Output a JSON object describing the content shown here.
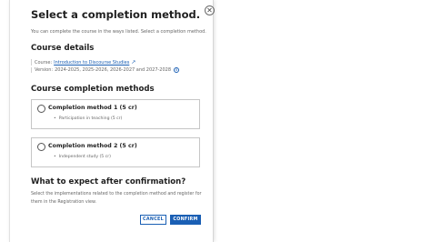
{
  "dialog": {
    "title": "Select a completion method.",
    "subtitle": "You can complete the course in the ways listed. Select a completion method.",
    "close_icon": "close-circle-icon"
  },
  "course_details": {
    "heading": "Course details",
    "course_label": "Course:",
    "course_link": "Introduction to Discourse Studies",
    "external_icon": "external-link-icon",
    "version_label": "Version:",
    "version_value": "2024-2025, 2025-2026, 2026-2027 and 2027-2028",
    "info_icon": "info-icon",
    "info_glyph": "i"
  },
  "methods": {
    "heading": "Course completion methods",
    "items": [
      {
        "name": "Completion method 1 (5 cr)",
        "detail": "Participation in teaching (5 cr)"
      },
      {
        "name": "Completion method 2 (5 cr)",
        "detail": "Independent study (5 cr)"
      }
    ]
  },
  "expect": {
    "heading": "What to expect after confirmation?",
    "text": "Select the implementations related to the completion method and register for them in the Registration view."
  },
  "buttons": {
    "cancel": "CANCEL",
    "confirm": "CONFIRM"
  },
  "colors": {
    "accent": "#1a5fb4",
    "text": "#1f1f1f",
    "muted": "#666666",
    "border": "#c6c6c6"
  }
}
